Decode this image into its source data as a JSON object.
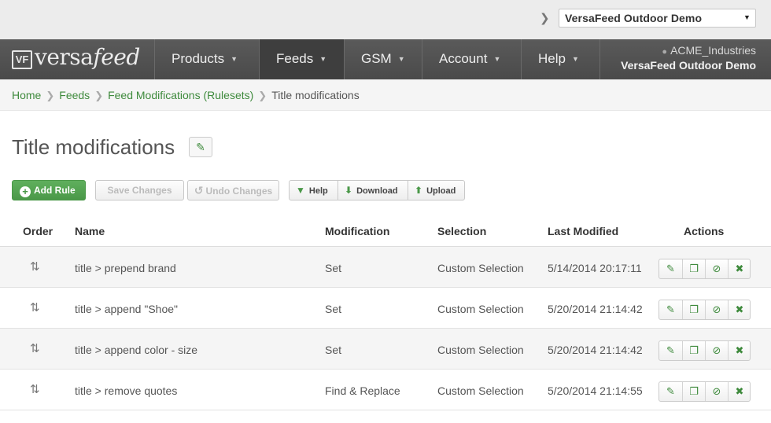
{
  "account_bar": {
    "selected_account": "VersaFeed Outdoor Demo"
  },
  "brand": {
    "logo_mark": "VF",
    "logo_text_plain": "versa",
    "logo_text_italic": "feed"
  },
  "nav": {
    "items": [
      {
        "label": "Products",
        "active": false
      },
      {
        "label": "Feeds",
        "active": true
      },
      {
        "label": "GSM",
        "active": false
      },
      {
        "label": "Account",
        "active": false
      },
      {
        "label": "Help",
        "active": false
      }
    ],
    "user": "ACME_Industries",
    "organization": "VersaFeed Outdoor Demo"
  },
  "breadcrumb": {
    "items": [
      "Home",
      "Feeds",
      "Feed Modifications (Rulesets)"
    ],
    "current": "Title modifications"
  },
  "page": {
    "title": "Title modifications"
  },
  "toolbar": {
    "add_label": "Add Rule",
    "save_label": "Save Changes",
    "undo_label": "Undo Changes",
    "help_label": "Help",
    "download_label": "Download",
    "upload_label": "Upload"
  },
  "table": {
    "headers": [
      "Order",
      "Name",
      "Modification",
      "Selection",
      "Last Modified",
      "Actions"
    ],
    "rows": [
      {
        "name": "title > prepend brand",
        "modification": "Set",
        "selection": "Custom Selection",
        "last_modified": "5/14/2014 20:17:11"
      },
      {
        "name": "title > append \"Shoe\"",
        "modification": "Set",
        "selection": "Custom Selection",
        "last_modified": "5/20/2014 21:14:42"
      },
      {
        "name": "title > append color - size",
        "modification": "Set",
        "selection": "Custom Selection",
        "last_modified": "5/20/2014 21:14:42"
      },
      {
        "name": "title > remove quotes",
        "modification": "Find & Replace",
        "selection": "Custom Selection",
        "last_modified": "5/20/2014 21:14:55"
      }
    ],
    "row_actions": [
      "edit-icon",
      "copy-icon",
      "disable-icon",
      "delete-icon"
    ]
  },
  "colors": {
    "accent_green": "#4a9848",
    "nav_bg": "#4a4a4a",
    "link_green": "#3e8a3c"
  }
}
